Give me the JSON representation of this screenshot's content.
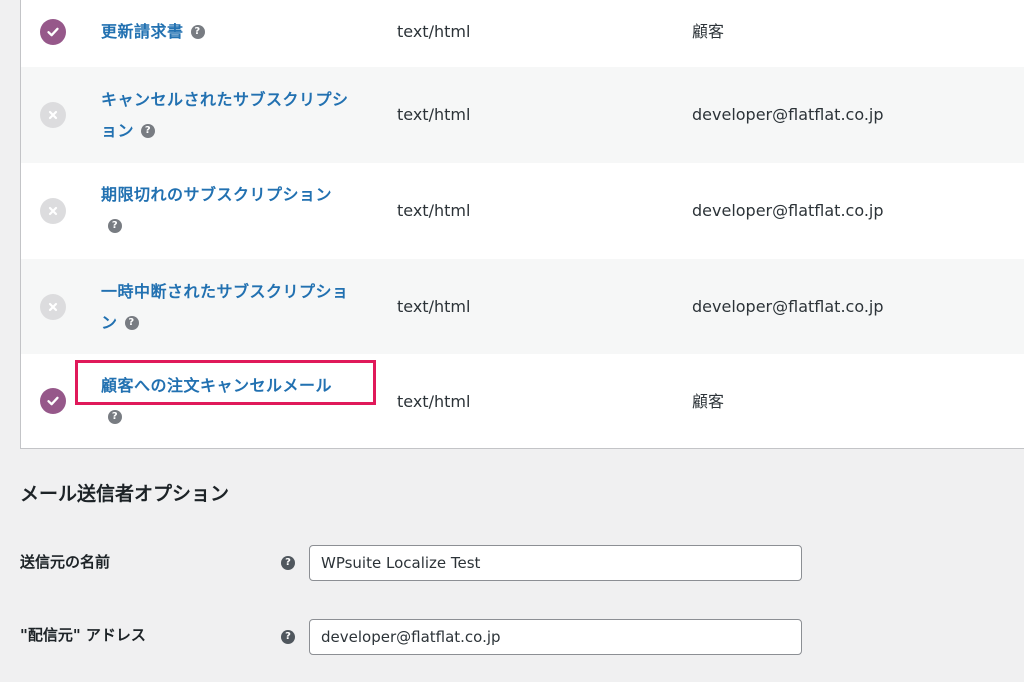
{
  "email_rows": [
    {
      "enabled": true,
      "name_lines": [
        "更新請求書"
      ],
      "content_type": "text/html",
      "recipient": "顧客"
    },
    {
      "enabled": false,
      "name_lines": [
        "キャンセルされたサブスクリプシ",
        "ョン"
      ],
      "content_type": "text/html",
      "recipient": "developer@flatflat.co.jp"
    },
    {
      "enabled": false,
      "name_lines": [
        "期限切れのサブスクリプション"
      ],
      "content_type": "text/html",
      "recipient": "developer@flatflat.co.jp"
    },
    {
      "enabled": false,
      "name_lines": [
        "一時中断されたサブスクリプショ",
        "ン"
      ],
      "content_type": "text/html",
      "recipient": "developer@flatflat.co.jp"
    },
    {
      "enabled": true,
      "name_lines": [
        "顧客への注文キャンセルメール"
      ],
      "content_type": "text/html",
      "recipient": "顧客"
    }
  ],
  "help_glyph": "?",
  "sender_section": {
    "title": "メール送信者オプション",
    "from_name": {
      "label": "送信元の名前",
      "value": "WPsuite Localize Test"
    },
    "from_address": {
      "label": "\"配信元\" アドレス",
      "value": "developer@flatflat.co.jp"
    }
  },
  "colors": {
    "link": "#2271b1",
    "enabled_status": "#96588a",
    "disabled_status": "#dcdcde",
    "highlight_border": "#e0195a"
  },
  "icons": {
    "enabled": "check-circle-icon",
    "disabled": "x-circle-icon",
    "help": "question-circle-icon"
  }
}
